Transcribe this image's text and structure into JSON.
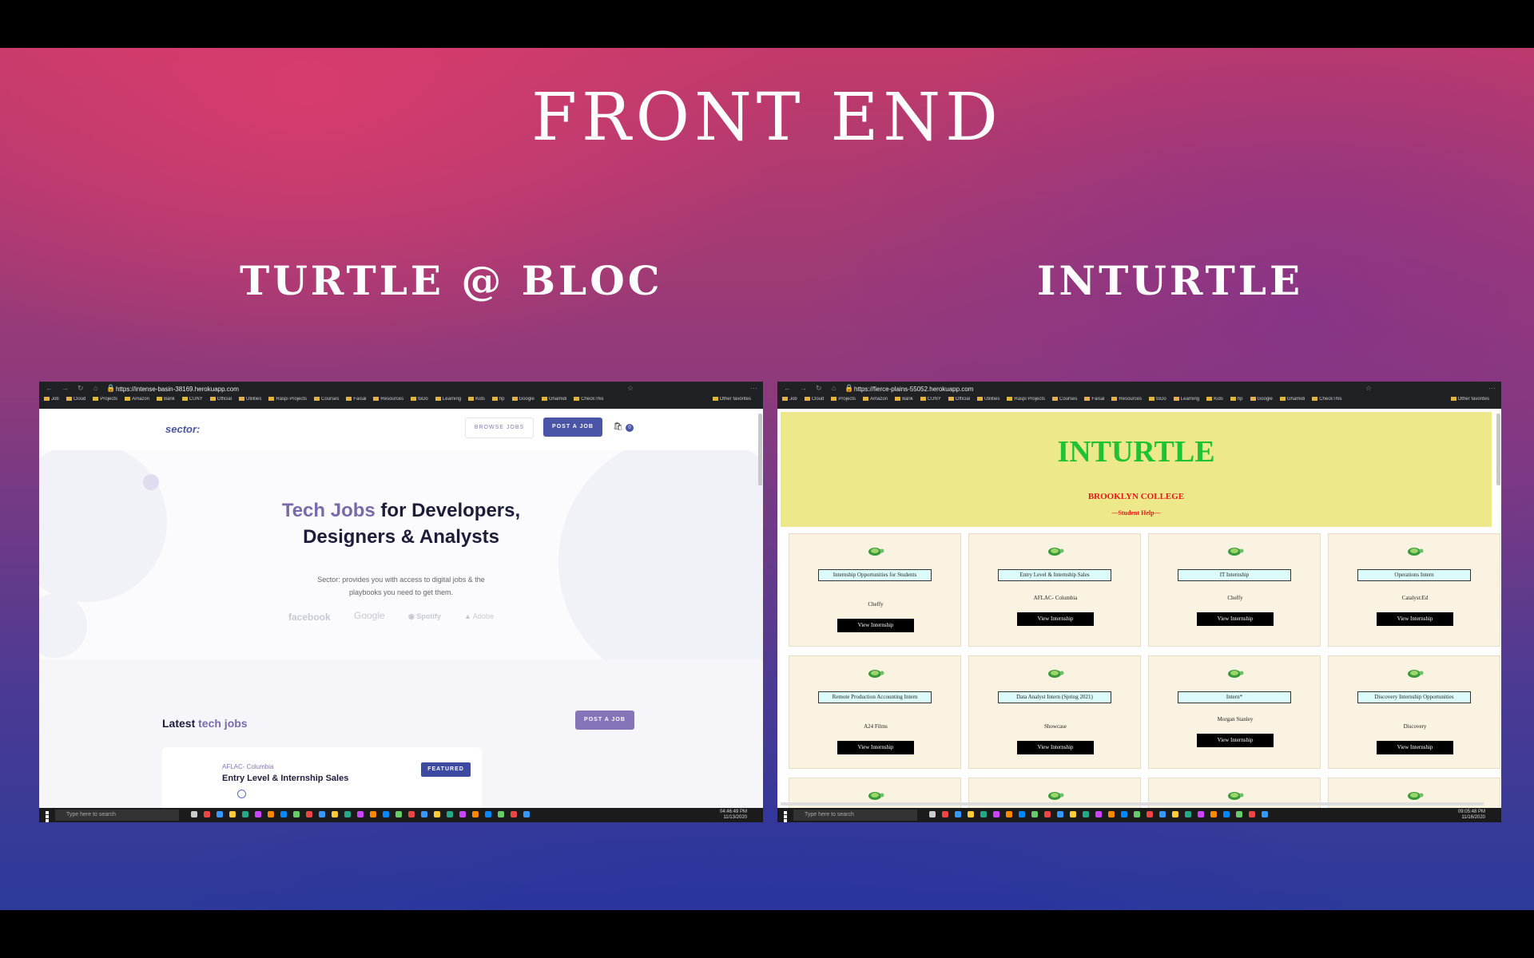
{
  "slide": {
    "title": "FRONT END",
    "left_label": "TURTLE @ BLOC",
    "right_label": "INTURTLE"
  },
  "left_window": {
    "url": "https://intense-basin-38169.herokuapp.com",
    "bookmarks": [
      "Job",
      "Cloud",
      "Projects",
      "Amazon",
      "Bank",
      "CUNY",
      "Official",
      "Utilities",
      "Raspi Projects",
      "Courses",
      "Faisal",
      "Resources",
      "toDo",
      "Learning",
      "Kids",
      "hp",
      "Google",
      "Ghamidi",
      "CheckThis"
    ],
    "other_favorites": "Other favorites",
    "site": {
      "logo": "sector:",
      "browse_jobs": "BROWSE JOBS",
      "post_job": "POST A JOB",
      "cart_count": "0",
      "hero_accent": "Tech Jobs",
      "hero_rest": "for Developers,",
      "hero_line2": "Designers & Analysts",
      "hero_desc_1": "Sector: provides you with access to digital jobs & the",
      "hero_desc_2": "playbooks you need to get them.",
      "brands": [
        "facebook",
        "Google",
        "Spotify",
        "Adobe"
      ],
      "latest_plain": "Latest",
      "latest_accent": "tech jobs",
      "post_job_2": "POST A JOB",
      "job": {
        "company": "AFLAC- Columbia",
        "title": "Entry Level & Internship Sales",
        "badge": "FEATURED"
      }
    },
    "taskbar": {
      "search": "Type here to search",
      "time": "04:46:49 PM",
      "date": "11/13/2020"
    }
  },
  "right_window": {
    "url": "https://fierce-plains-55052.herokuapp.com",
    "bookmarks": [
      "Job",
      "Cloud",
      "Projects",
      "Amazon",
      "Bank",
      "CUNY",
      "Official",
      "Utilities",
      "Raspi Projects",
      "Courses",
      "Faisal",
      "Resources",
      "toDo",
      "Learning",
      "Kids",
      "hp",
      "Google",
      "Ghamidi",
      "CheckThis"
    ],
    "other_favorites": "Other favorites",
    "site": {
      "title": "INTURTLE",
      "college": "BROOKLYN COLLEGE",
      "help": "—Student Help—",
      "view_label": "View Internship",
      "cards": [
        {
          "title": "Internship Opportunities for Students",
          "company": "Cheffy"
        },
        {
          "title": "Entry Level & Internship Sales",
          "company": "AFLAC- Columbia"
        },
        {
          "title": "IT Internship",
          "company": "Cheffy"
        },
        {
          "title": "Operations Intern",
          "company": "Catalyst:Ed"
        },
        {
          "title": "Remote Production Accounting Intern",
          "company": "A24 Films"
        },
        {
          "title": "Data Analyst Intern (Spring 2021)",
          "company": "Showcase"
        },
        {
          "title": "Intern*",
          "company": "Morgan Stanley"
        },
        {
          "title": "Discovery Internship Opportunities",
          "company": "Discovery"
        }
      ]
    },
    "taskbar": {
      "search": "Type here to search",
      "time": "09:05:48 PM",
      "date": "11/16/2020"
    }
  }
}
